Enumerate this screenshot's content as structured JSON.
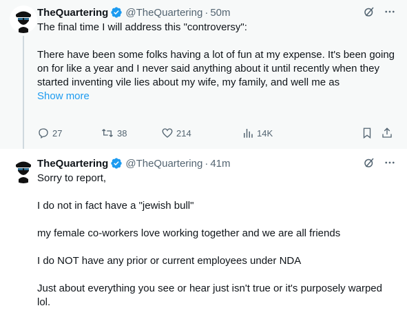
{
  "tweets": [
    {
      "display_name": "TheQuartering",
      "handle": "@TheQuartering",
      "separator": "·",
      "time": "50m",
      "paragraphs": [
        "The final time I will address this \"controversy\":",
        "There have been some folks having a lot of fun at my expense.  It's been going on for like a year and I never said anything about it until recently when they started inventing vile lies about my wife, my family, and well me as"
      ],
      "show_more": "Show more",
      "replies": "27",
      "retweets": "38",
      "likes": "214",
      "views": "14K"
    },
    {
      "display_name": "TheQuartering",
      "handle": "@TheQuartering",
      "separator": "·",
      "time": "41m",
      "paragraphs": [
        "Sorry to report,",
        "I do not in fact have a \"jewish bull\"",
        "my female co-workers love working together and we are all friends",
        "I do NOT have any prior or current employees under NDA",
        "Just about everything you see or hear just isn't true or it's purposely warped lol."
      ]
    }
  ],
  "colors": {
    "accent": "#1d9bf0",
    "muted": "#536471",
    "text": "#0f1419",
    "thread_line": "#cfd9de",
    "tweet1_bg": "#f7f9f9"
  }
}
